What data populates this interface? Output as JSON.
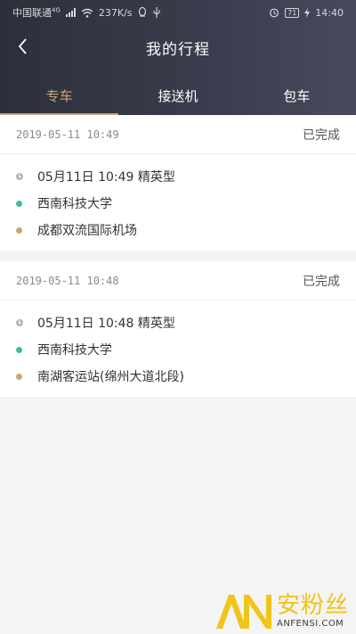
{
  "status_bar": {
    "carrier": "中国联通",
    "network": "4G",
    "speed": "237K/s",
    "battery": "71",
    "time": "14:40"
  },
  "header": {
    "title": "我的行程"
  },
  "tabs": [
    {
      "label": "专车",
      "active": true
    },
    {
      "label": "接送机",
      "active": false
    },
    {
      "label": "包车",
      "active": false
    }
  ],
  "trips": [
    {
      "datetime": "2019-05-11 10:49",
      "status": "已完成",
      "time_detail": "05月11日  10:49 精英型",
      "from": "西南科技大学",
      "to": "成都双流国际机场"
    },
    {
      "datetime": "2019-05-11 10:48",
      "status": "已完成",
      "time_detail": "05月11日  10:48 精英型",
      "from": "西南科技大学",
      "to": "南湖客运站(绵州大道北段)"
    }
  ],
  "watermark": {
    "logo": "AN",
    "text_cn": "安粉丝",
    "text_en": "ANFENSI.COM"
  },
  "colors": {
    "header_bg": "#2d2f3b",
    "accent": "#caa37a",
    "from_dot": "#3ebba0",
    "to_dot": "#cfa373"
  }
}
